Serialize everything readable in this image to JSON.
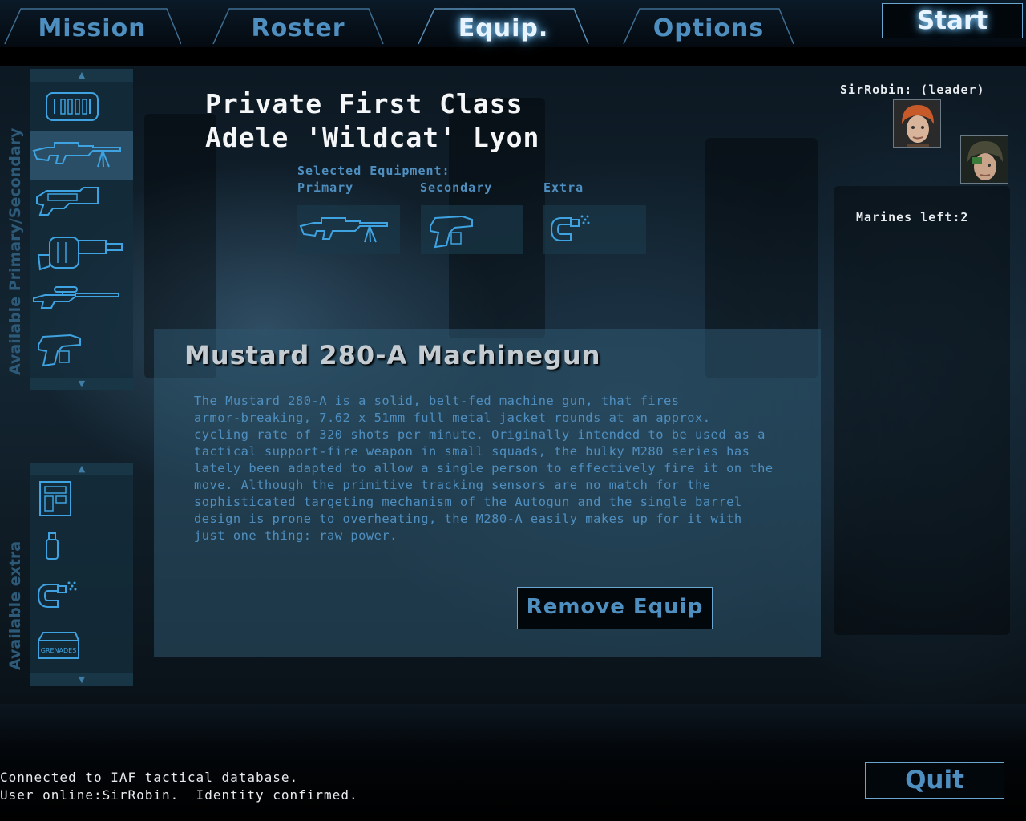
{
  "tabs": [
    {
      "label": "Mission",
      "active": false
    },
    {
      "label": "Roster",
      "active": false
    },
    {
      "label": "Equip.",
      "active": true
    },
    {
      "label": "Options",
      "active": false
    }
  ],
  "start_label": "Start",
  "side_panels": {
    "primary_label": "Available Primary/Secondary",
    "extra_label": "Available extra",
    "primary_items": [
      "ammo-crate-icon",
      "machinegun-icon",
      "shotgun-icon",
      "flamethrower-icon",
      "sniper-rifle-icon",
      "pistol-icon"
    ],
    "extra_items": [
      "medkit-device-icon",
      "spray-can-icon",
      "welder-icon",
      "grenades-icon"
    ],
    "grenades_text": "GRENADES",
    "up_arrow": "▲",
    "down_arrow": "▼"
  },
  "soldier": {
    "rank": "Private First Class",
    "name": "Adele 'Wildcat' Lyon"
  },
  "selected_equipment": {
    "title": "Selected Equipment:",
    "primary_label": "Primary",
    "secondary_label": "Secondary",
    "extra_label": "Extra"
  },
  "weapon": {
    "title": "Mustard 280-A Machinegun",
    "description": "The Mustard 280-A is a solid, belt-fed machine gun, that fires\narmor-breaking, 7.62 x 51mm full metal jacket rounds at an approx.\ncycling rate of 320 shots per minute. Originally intended to be used as a\ntactical support-fire weapon in small squads, the bulky M280 series has\nlately been adapted to allow a single person to effectively fire it on the\nmove. Although the primitive tracking sensors are no match for the\nsophisticated targeting mechanism of the Autogun and the single barrel\ndesign is prone to overheating, the M280-A easily makes up for it with\njust one thing: raw power."
  },
  "remove_label": "Remove Equip",
  "roster": {
    "leader_label": "SirRobin: (leader)",
    "marines_left": "Marines left:2"
  },
  "status": {
    "line1": "Connected to IAF tactical database.",
    "line2": "User online:SirRobin.  Identity confirmed."
  },
  "quit_label": "Quit",
  "colors": {
    "accent": "#4f8fc0",
    "glow": "#8fd0ff",
    "panel": "#2d556e"
  }
}
